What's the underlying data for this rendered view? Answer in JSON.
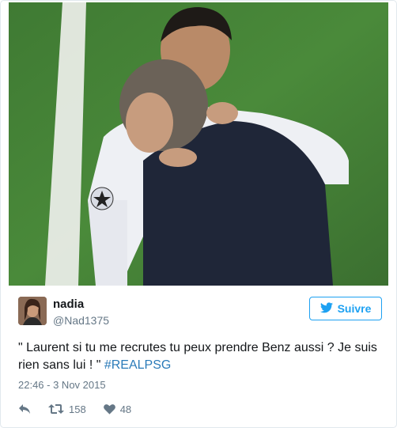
{
  "tweet": {
    "author_name": "nadia",
    "author_handle": "@Nad1375",
    "follow_label": "Suivre",
    "text": "\" Laurent si tu me recrutes tu peux prendre Benz aussi ? Je suis rien sans lui ! \" ",
    "hashtag": "#REALPSG",
    "timestamp": "22:46 - 3 Nov 2015",
    "retweet_count": "158",
    "like_count": "48"
  },
  "icons": {
    "follow": "twitter-bird-icon",
    "reply": "reply-icon",
    "retweet": "retweet-icon",
    "like": "heart-icon"
  },
  "colors": {
    "accent": "#1da1f2",
    "hashtag": "#2b7bb9",
    "muted": "#657786"
  }
}
